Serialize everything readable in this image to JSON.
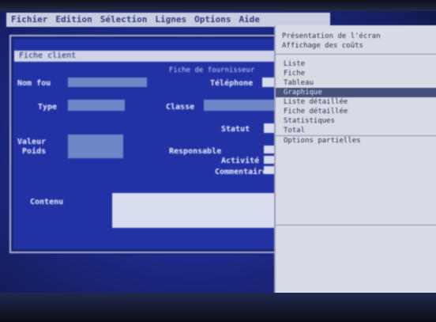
{
  "menu": {
    "items": [
      "Fichier",
      "Edition",
      "Sélection",
      "Lignes",
      "Options",
      "Aide"
    ]
  },
  "window": {
    "title": "Fiche client"
  },
  "form": {
    "labels": {
      "name": "Nom fou",
      "type": "Type",
      "phone": "Téléphone",
      "category": "Classe",
      "status": "Statut",
      "value": "Valeur",
      "weight": "Poids",
      "responsible": "Responsable",
      "activity": "Activité",
      "comment": "Commentaire",
      "content": "Contenu"
    },
    "header_text": "Fiche de fournisseur"
  },
  "popup": {
    "header_line1": "Présentation de l'écran",
    "header_line2": "Affichage des coûts",
    "items": [
      "Liste",
      "Fiche",
      "Tableau",
      "Graphique",
      "Liste détaillée",
      "Fiche détaillée",
      "Statistiques",
      "Total",
      "Options partielles"
    ],
    "selected_index": 3
  }
}
